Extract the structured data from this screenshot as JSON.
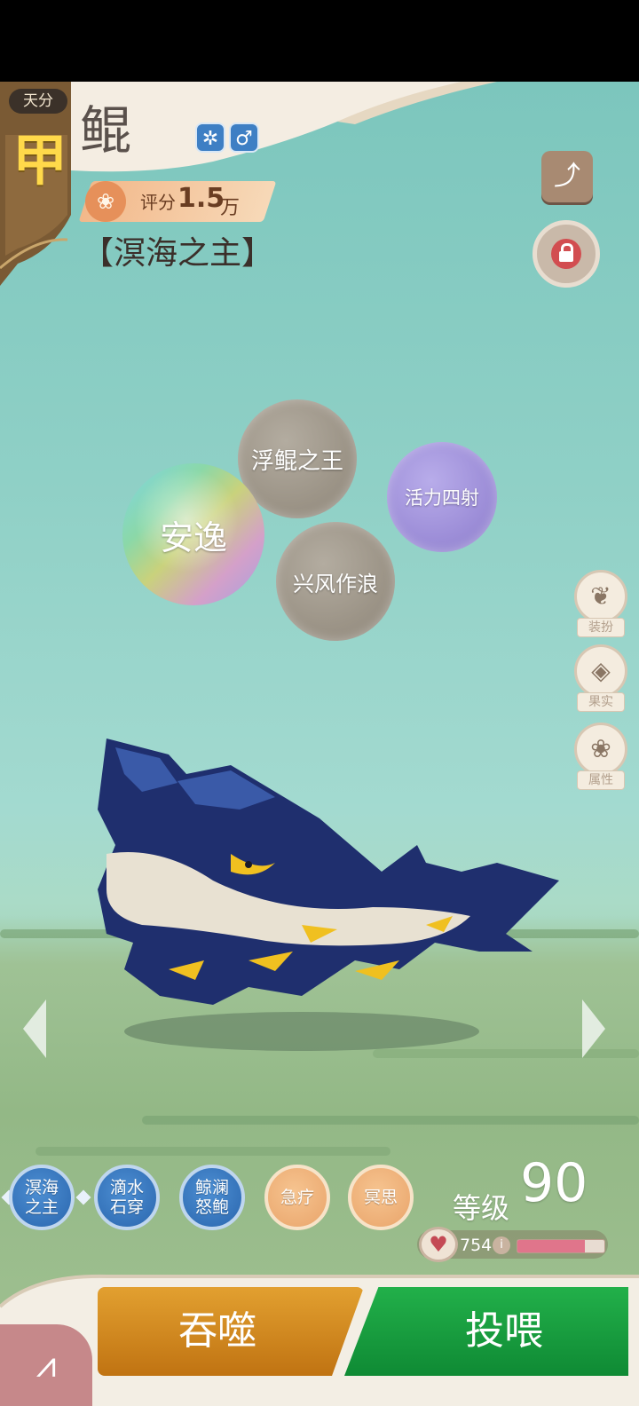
{
  "header": {
    "tier_label": "天分",
    "tier_char": "甲",
    "pet_name": "鲲",
    "element_icon": "swirl-icon",
    "gender_symbol": "♂",
    "score_label": "评分",
    "score_value": "1.5",
    "score_unit": "万",
    "title": "【溟海之主】"
  },
  "top_buttons": {
    "share_icon": "share-icon",
    "lock_icon": "lock-icon"
  },
  "traits": {
    "t1": "浮鲲之王",
    "t2": "活力四射",
    "t3": "安逸",
    "t4": "兴风作浪"
  },
  "side_menu": [
    {
      "label": "装扮",
      "icon": "butterfly-icon"
    },
    {
      "label": "果实",
      "icon": "fruit-icon"
    },
    {
      "label": "属性",
      "icon": "paw-icon"
    }
  ],
  "skills": [
    {
      "label": "溟海之主",
      "style": "blue"
    },
    {
      "label": "滴水石穿",
      "style": "blue"
    },
    {
      "label": "鲸澜怒鲍",
      "style": "blue"
    },
    {
      "label": "急疗",
      "style": "orange"
    },
    {
      "label": "冥思",
      "style": "orange"
    }
  ],
  "level": {
    "label": "等级",
    "value": "90"
  },
  "hp": {
    "value": "754",
    "fill_fraction": 0.78
  },
  "actions": {
    "devour": "吞噬",
    "feed": "投喂"
  },
  "colors": {
    "devour": "#d18a22",
    "feed": "#1aa043",
    "skill_blue": "#2a66ae",
    "skill_orange": "#e9a46a"
  }
}
